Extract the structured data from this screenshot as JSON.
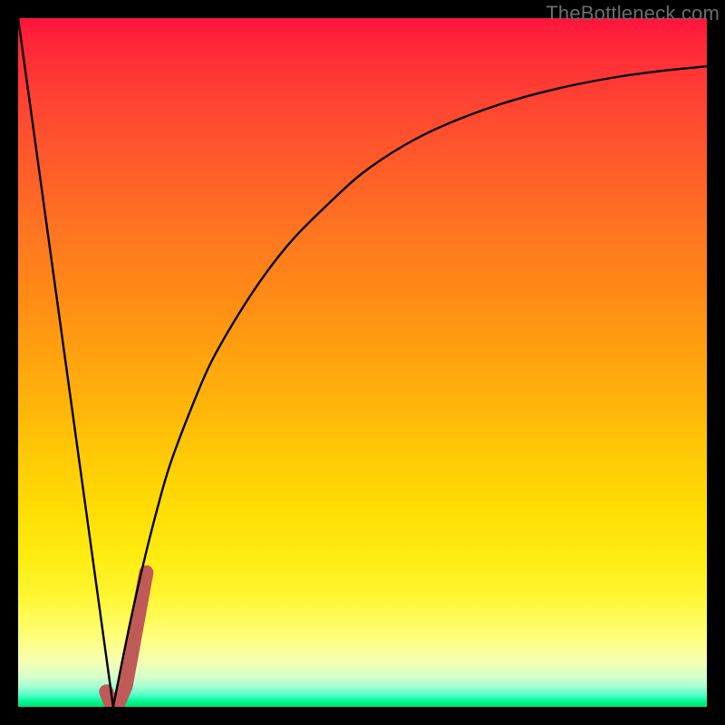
{
  "watermark_text": "TheBottleneck.com",
  "colors": {
    "frame": "#000000",
    "curve": "#000000",
    "highlight": "#c05a56"
  },
  "chart_data": {
    "type": "line",
    "title": "",
    "xlabel": "",
    "ylabel": "",
    "xlim": [
      0,
      100
    ],
    "ylim": [
      0,
      100
    ],
    "series": [
      {
        "name": "left-leg",
        "x": [
          0,
          13.8
        ],
        "y": [
          100,
          0
        ]
      },
      {
        "name": "right-curve",
        "x": [
          13.8,
          16,
          18,
          20,
          22,
          25,
          28,
          32,
          36,
          40,
          45,
          50,
          56,
          62,
          70,
          78,
          86,
          93,
          100
        ],
        "y": [
          0,
          11,
          20,
          28,
          35,
          43,
          50,
          57,
          63,
          68,
          73,
          77.5,
          81.5,
          84.5,
          87.5,
          89.7,
          91.3,
          92.3,
          93
        ]
      }
    ],
    "highlight_segment": {
      "name": "highlight",
      "path_desc": "short J-shaped thick pink segment near the minimum",
      "points": [
        {
          "x": 12.8,
          "y": 2.2
        },
        {
          "x": 13.4,
          "y": 0.7
        },
        {
          "x": 14.6,
          "y": 0.7
        },
        {
          "x": 15.6,
          "y": 3.0
        },
        {
          "x": 18.6,
          "y": 19.5
        }
      ]
    }
  }
}
